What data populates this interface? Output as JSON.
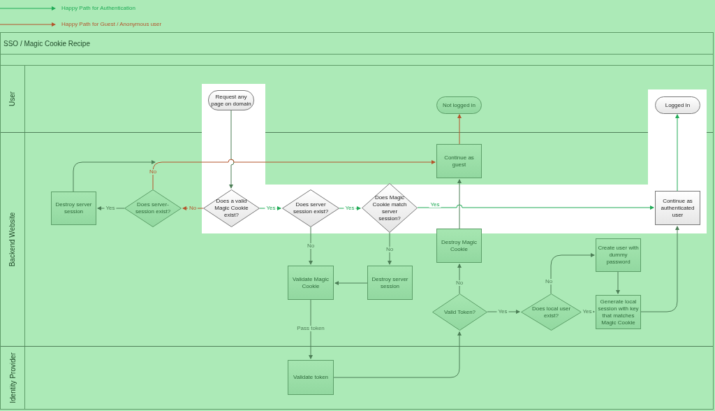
{
  "legend": [
    {
      "kind": "auth",
      "label": "Happy Path for Authentication"
    },
    {
      "kind": "guest",
      "label": "Happy Path for Guest / Anonymous user"
    }
  ],
  "diagram": {
    "title": "SSO / Magic Cookie Recipe",
    "lanes": [
      {
        "label": "User"
      },
      {
        "label": "Backend Website"
      },
      {
        "label": "Identity Provider"
      }
    ],
    "nodes": [
      {
        "kind": "terminal",
        "text": "Request any page on domain",
        "highlighted": true
      },
      {
        "kind": "terminal",
        "text": "Not logged in",
        "highlighted": false
      },
      {
        "kind": "terminal",
        "text": "Logged In",
        "highlighted": true
      },
      {
        "kind": "process",
        "text": "Continue as guest",
        "highlighted": false
      },
      {
        "kind": "process",
        "text": "Destroy server session",
        "highlighted": false
      },
      {
        "kind": "decision",
        "text": "Does server-session exist?",
        "highlighted": false
      },
      {
        "kind": "decision",
        "text": "Does a valid Magic Cookie exist?",
        "highlighted": true
      },
      {
        "kind": "decision",
        "text": "Does server session exist?",
        "highlighted": true
      },
      {
        "kind": "decision",
        "text": "Does Magic Cookie match server session?",
        "highlighted": true
      },
      {
        "kind": "process",
        "text": "Continue as authenticated user",
        "highlighted": true
      },
      {
        "kind": "process",
        "text": "Destroy Magic Cookie",
        "highlighted": false
      },
      {
        "kind": "process",
        "text": "Validate Magic Cookie",
        "highlighted": false
      },
      {
        "kind": "process",
        "text": "Destroy server session",
        "highlighted": false
      },
      {
        "kind": "process",
        "text": "Create user with dummy password",
        "highlighted": false
      },
      {
        "kind": "decision",
        "text": "Valid Token?",
        "highlighted": false
      },
      {
        "kind": "decision",
        "text": "Does local user exist?",
        "highlighted": false
      },
      {
        "kind": "process",
        "text": "Generate local session with key that matches Magic Cookie",
        "highlighted": false
      },
      {
        "kind": "process",
        "text": "Validate token",
        "highlighted": false
      }
    ],
    "edges": [
      {
        "kind": "neutral"
      },
      {
        "kind": "guest"
      },
      {
        "kind": "auth"
      },
      {
        "kind": "neutral"
      },
      {
        "kind": "guest",
        "label": "No"
      },
      {
        "kind": "neutral",
        "label": "Yes"
      },
      {
        "kind": "guest",
        "label": "No"
      },
      {
        "kind": "auth",
        "label": "Yes"
      },
      {
        "kind": "auth",
        "label": "Yes"
      },
      {
        "kind": "auth",
        "label": "Yes"
      },
      {
        "kind": "neutral",
        "label": "No"
      },
      {
        "kind": "neutral"
      },
      {
        "kind": "neutral",
        "label": "No"
      },
      {
        "kind": "neutral"
      },
      {
        "kind": "neutral",
        "label": "No"
      },
      {
        "kind": "neutral",
        "label": "No"
      },
      {
        "kind": "neutral"
      },
      {
        "kind": "neutral",
        "label": "Pass token"
      },
      {
        "kind": "neutral",
        "label": "Yes"
      },
      {
        "kind": "neutral",
        "label": "Yes"
      },
      {
        "kind": "neutral"
      },
      {
        "kind": "neutral"
      }
    ]
  }
}
